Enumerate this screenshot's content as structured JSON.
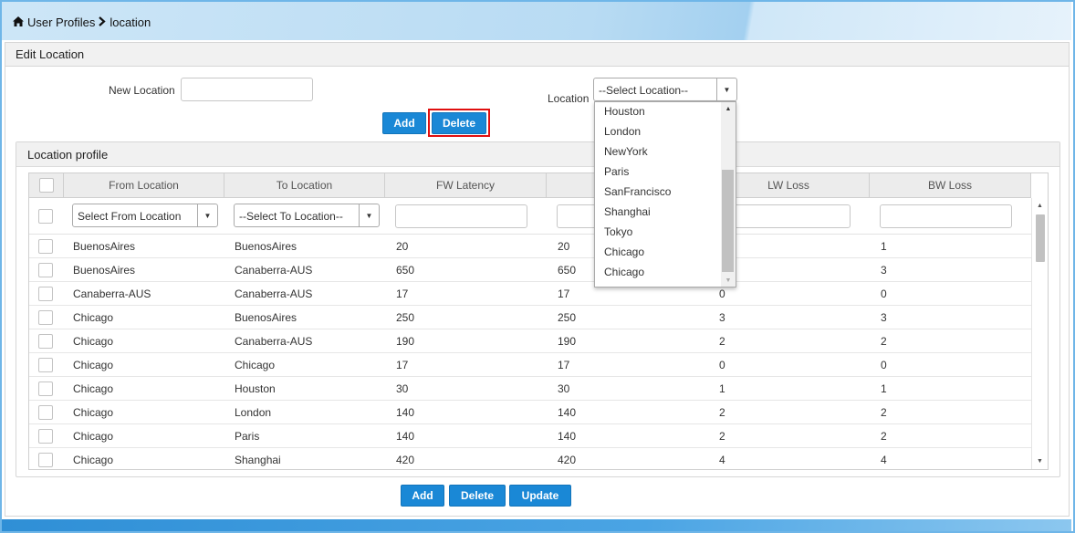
{
  "breadcrumb": {
    "home_icon": "home-icon",
    "root": "User Profiles",
    "separator_icon": "chevron-right-icon",
    "current": "location"
  },
  "edit_panel": {
    "title": "Edit Location",
    "new_location_label": "New Location",
    "new_location_value": "",
    "location_label": "Location",
    "location_select_value": "--Select Location--",
    "add_label": "Add",
    "delete_label": "Delete"
  },
  "location_dropdown": {
    "options": [
      "Houston",
      "London",
      "NewYork",
      "Paris",
      "SanFrancisco",
      "Shanghai",
      "Tokyo",
      "Chicago",
      "Chicago"
    ]
  },
  "profile_panel": {
    "title": "Location profile",
    "columns": [
      "From Location",
      "To Location",
      "FW Latency",
      "",
      "LW Loss",
      "BW Loss"
    ],
    "filters": {
      "from_select": "Select From Location",
      "to_select": "--Select To Location--"
    },
    "rows": [
      [
        "BuenosAires",
        "BuenosAires",
        "20",
        "20",
        "",
        "1"
      ],
      [
        "BuenosAires",
        "Canaberra-AUS",
        "650",
        "650",
        "",
        "3"
      ],
      [
        "Canaberra-AUS",
        "Canaberra-AUS",
        "17",
        "17",
        "0",
        "0"
      ],
      [
        "Chicago",
        "BuenosAires",
        "250",
        "250",
        "3",
        "3"
      ],
      [
        "Chicago",
        "Canaberra-AUS",
        "190",
        "190",
        "2",
        "2"
      ],
      [
        "Chicago",
        "Chicago",
        "17",
        "17",
        "0",
        "0"
      ],
      [
        "Chicago",
        "Houston",
        "30",
        "30",
        "1",
        "1"
      ],
      [
        "Chicago",
        "London",
        "140",
        "140",
        "2",
        "2"
      ],
      [
        "Chicago",
        "Paris",
        "140",
        "140",
        "2",
        "2"
      ],
      [
        "Chicago",
        "Shanghai",
        "420",
        "420",
        "4",
        "4"
      ]
    ]
  },
  "footer_buttons": {
    "add": "Add",
    "delete": "Delete",
    "update": "Update"
  },
  "colors": {
    "button_blue": "#1a88d6",
    "highlight_red": "#e01010",
    "top_bar": "#b8dbf3"
  }
}
